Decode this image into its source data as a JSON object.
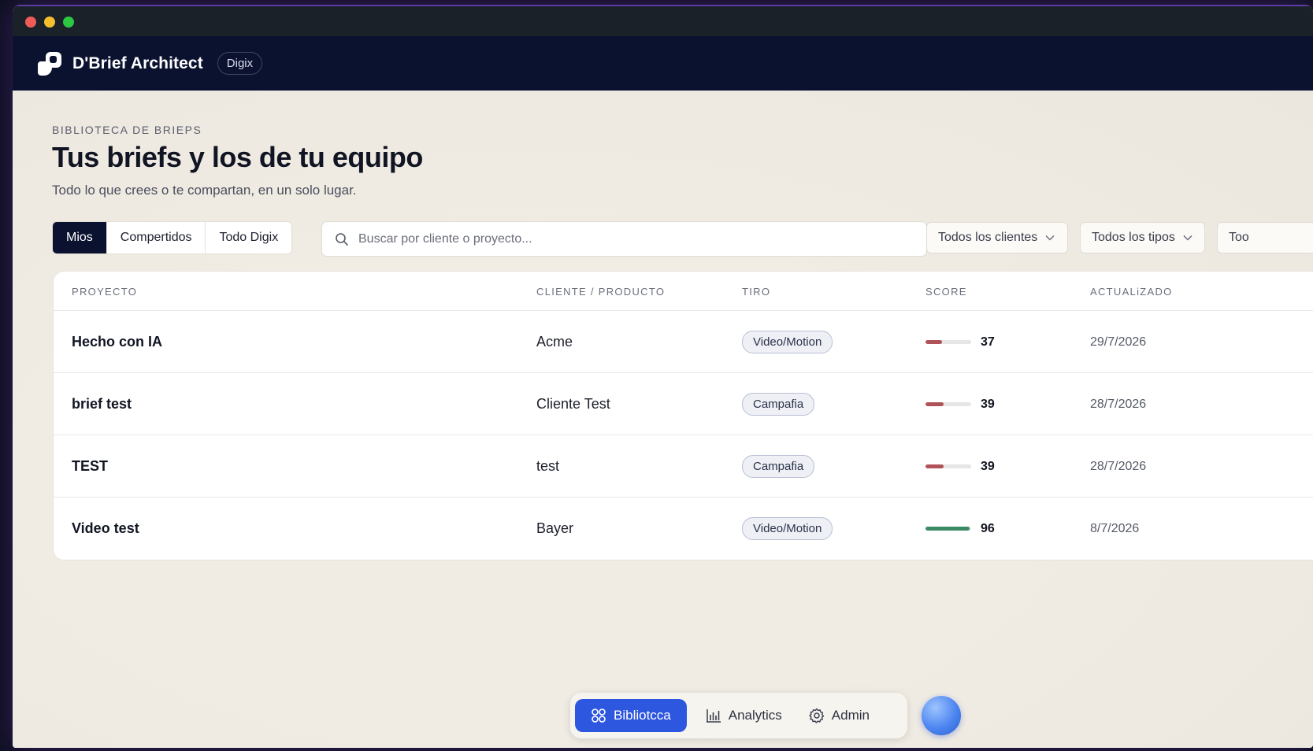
{
  "app": {
    "name": "D'Brief Architect",
    "org": "Digix"
  },
  "header": {
    "eyebrow": "BIBLIOTECA DE BRIEPS",
    "title": "Tus briefs y los de tu equipo",
    "subtitle": "Todo lo que crees o te compartan, en un solo lugar."
  },
  "tabs": [
    {
      "label": "Mios",
      "active": true
    },
    {
      "label": "Compertidos",
      "active": false
    },
    {
      "label": "Todo Digix",
      "active": false
    }
  ],
  "search": {
    "placeholder": "Buscar por cliente o proyecto..."
  },
  "filters": [
    {
      "label": "Todos los clientes"
    },
    {
      "label": "Todos los tipos"
    },
    {
      "label": "Too"
    }
  ],
  "table": {
    "columns": [
      "PROYECTO",
      "CLIENTE / PRODUCTO",
      "TIRO",
      "SCORE",
      "ACTUALiZADO"
    ],
    "rows": [
      {
        "project": "Hecho con IA",
        "client": "Acme",
        "type": "Video/Motion",
        "score": 37,
        "score_color": "#b0525a",
        "updated": "29/7/2026"
      },
      {
        "project": "brief test",
        "client": "Cliente Test",
        "type": "Campafia",
        "score": 39,
        "score_color": "#b0525a",
        "updated": "28/7/2026"
      },
      {
        "project": "TEST",
        "client": "test",
        "type": "Campafia",
        "score": 39,
        "score_color": "#b0525a",
        "updated": "28/7/2026"
      },
      {
        "project": "Video test",
        "client": "Bayer",
        "type": "Video/Motion",
        "score": 96,
        "score_color": "#3c8a63",
        "updated": "8/7/2026"
      }
    ]
  },
  "nav": {
    "items": [
      {
        "label": "Bibliotcca",
        "icon": "grid-icon",
        "active": true
      },
      {
        "label": "Analytics",
        "icon": "bar-chart-icon",
        "active": false
      },
      {
        "label": "Admin",
        "icon": "gear-icon",
        "active": false
      }
    ]
  },
  "colors": {
    "navy": "#0b1230",
    "accent": "#2e57e0",
    "score_low": "#b0525a",
    "score_high": "#3c8a63"
  }
}
